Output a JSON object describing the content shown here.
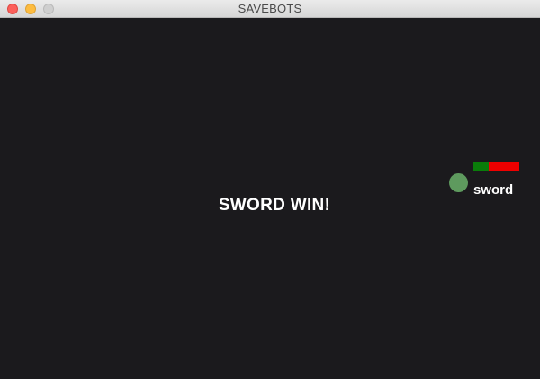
{
  "window": {
    "title": "SAVEBOTS"
  },
  "game": {
    "message": "SWORD WIN!",
    "bot": {
      "name": "sword",
      "health_fraction": 0.33,
      "colors": {
        "body": "#5e9a5e",
        "health_fill": "#0a7d0a",
        "health_empty": "#ee0000"
      }
    }
  }
}
